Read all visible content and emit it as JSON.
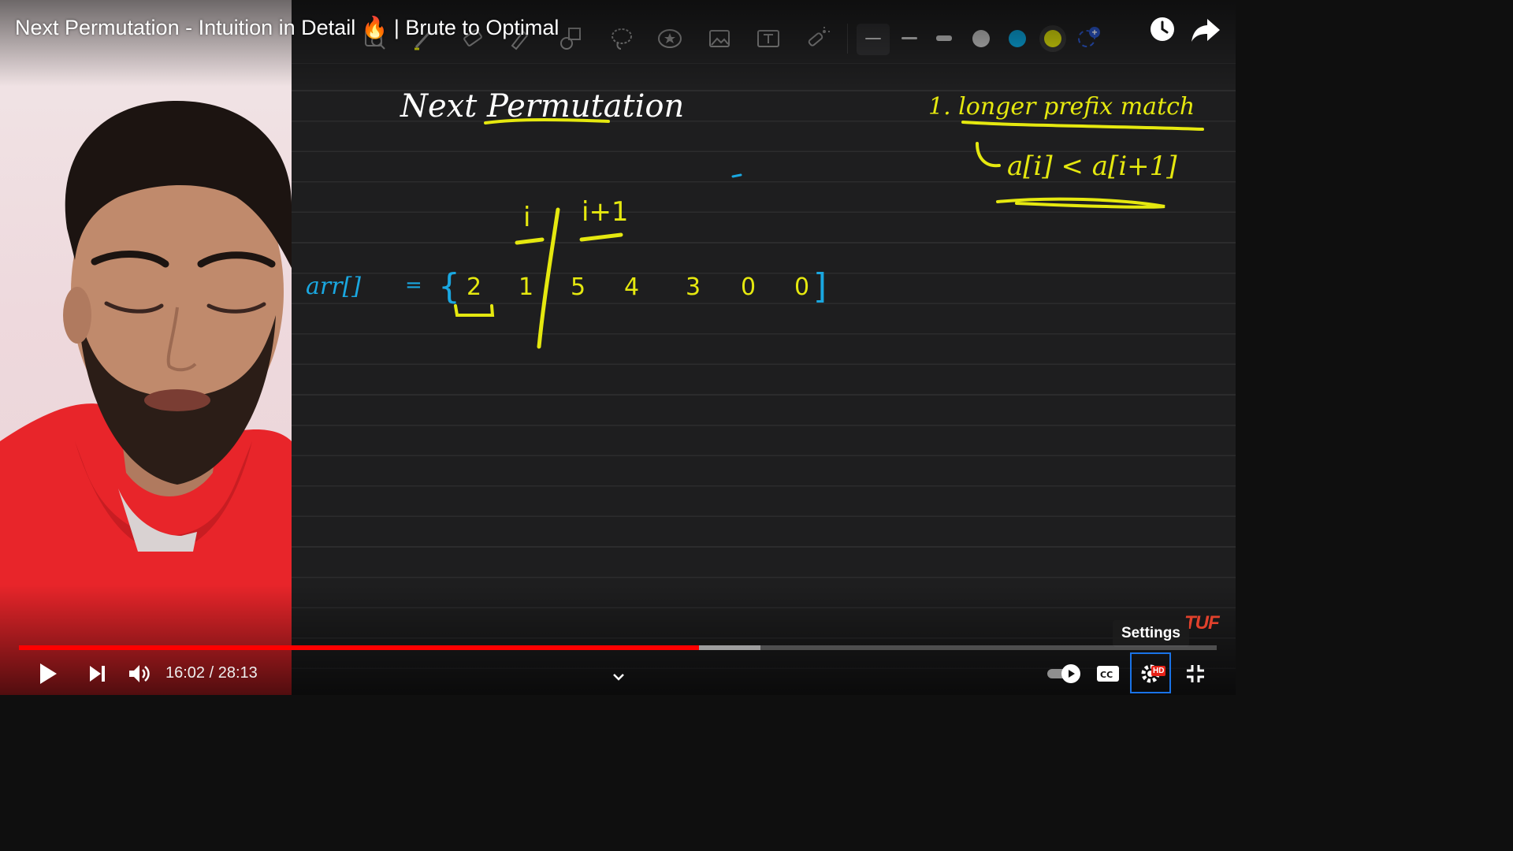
{
  "player": {
    "title": "Next Permutation - Intuition in Detail 🔥 | Brute to Optimal",
    "time_current": "16:02",
    "time_separator": " / ",
    "time_total": "28:13",
    "progress_played_fraction": 0.568,
    "progress_buffered_fraction": 0.619,
    "tooltip": "Settings",
    "hd_badge": "HD",
    "watermark": "TUF",
    "accent_color": "#ff0000"
  },
  "board_toolbar": {
    "tools": [
      "zoom-tool-icon",
      "pen-icon",
      "eraser-icon",
      "highlighter-icon",
      "shapes-icon",
      "lasso-icon",
      "sticker-icon",
      "image-icon",
      "text-box-icon",
      "laser-pointer-icon"
    ],
    "colors": [
      "#bdbdbd",
      "#0aa0d6",
      "#d4d70b"
    ],
    "selected_color": "#d4d70b"
  },
  "whiteboard": {
    "heading": "Next Permutation",
    "note_point": "1. longer prefix match",
    "note_condition": "a[i] < a[i+1]",
    "label_i": "i",
    "label_i_plus_1": "i+1",
    "array_name": "arr[]",
    "equals": "=",
    "array_values": [
      "2",
      "1",
      "5",
      "4",
      "3",
      "0",
      "0"
    ]
  }
}
